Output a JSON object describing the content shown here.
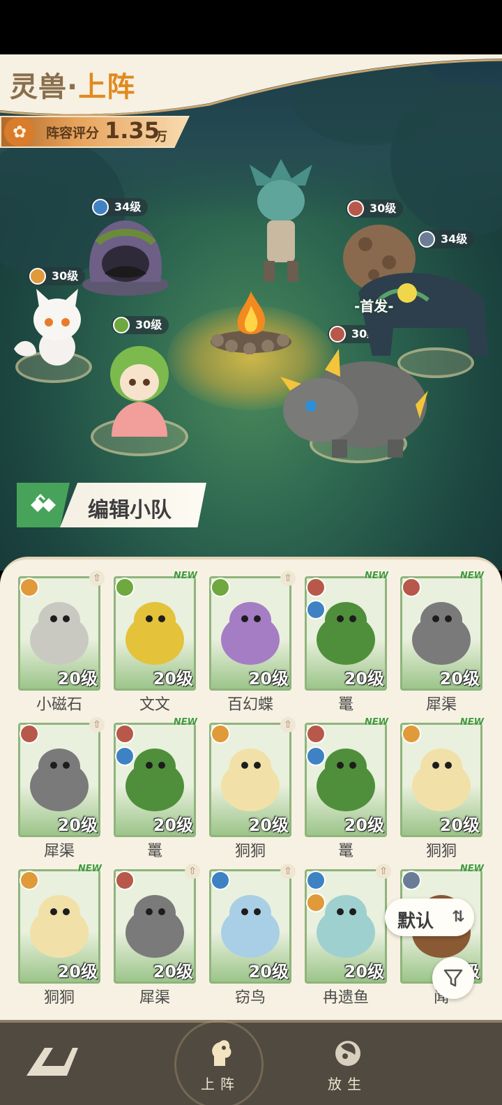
{
  "header": {
    "title_main": "灵兽·",
    "title_accent": "上阵",
    "score_label": "阵容评分",
    "score_value": "1.35",
    "score_unit": "万"
  },
  "battle": {
    "captain_label": "-首发-",
    "units": [
      {
        "id": "hooded",
        "level": "34级",
        "element": "water"
      },
      {
        "id": "masked",
        "level": "",
        "element": ""
      },
      {
        "id": "boulder",
        "level": "30级",
        "element": "fire"
      },
      {
        "id": "beast",
        "level": "34级",
        "element": "metal"
      },
      {
        "id": "fox",
        "level": "30级",
        "element": "light"
      },
      {
        "id": "sprout",
        "level": "30级",
        "element": "grass"
      },
      {
        "id": "rhino",
        "level": "30级",
        "element": "fire"
      }
    ],
    "edit_team_label": "编辑小队"
  },
  "cards": [
    {
      "name": "小磁石",
      "level": "20级",
      "element": "light",
      "new": false,
      "up": true,
      "color": "#c9c9c2"
    },
    {
      "name": "文文",
      "level": "20级",
      "element": "grass",
      "new": true,
      "up": false,
      "color": "#e4c23a"
    },
    {
      "name": "百幻蝶",
      "level": "20级",
      "element": "grass",
      "new": false,
      "up": true,
      "color": "#a57dc4"
    },
    {
      "name": "鼍",
      "level": "20级",
      "element": "fire",
      "element2": "water",
      "new": true,
      "up": false,
      "color": "#4f8f3b"
    },
    {
      "name": "犀渠",
      "level": "20级",
      "element": "fire",
      "new": true,
      "up": false,
      "color": "#7a7a7a"
    },
    {
      "name": "犀渠",
      "level": "20级",
      "element": "fire",
      "new": false,
      "up": true,
      "color": "#7a7a7a"
    },
    {
      "name": "鼍",
      "level": "20级",
      "element": "fire",
      "element2": "water",
      "new": true,
      "up": false,
      "color": "#4f8f3b"
    },
    {
      "name": "狪狪",
      "level": "20级",
      "element": "light",
      "new": false,
      "up": true,
      "color": "#f1e1a8"
    },
    {
      "name": "鼍",
      "level": "20级",
      "element": "fire",
      "element2": "water",
      "new": true,
      "up": false,
      "color": "#4f8f3b"
    },
    {
      "name": "狪狪",
      "level": "20级",
      "element": "light",
      "new": true,
      "up": false,
      "color": "#f1e1a8"
    },
    {
      "name": "狪狪",
      "level": "20级",
      "element": "light",
      "new": true,
      "up": false,
      "color": "#f1e1a8"
    },
    {
      "name": "犀渠",
      "level": "20级",
      "element": "fire",
      "new": false,
      "up": true,
      "color": "#7a7a7a"
    },
    {
      "name": "窃鸟",
      "level": "20级",
      "element": "water",
      "new": false,
      "up": true,
      "color": "#a9cfe6"
    },
    {
      "name": "冉遗鱼",
      "level": "20级",
      "element": "water",
      "element2": "light",
      "new": false,
      "up": true,
      "color": "#9fd0d0"
    },
    {
      "name": "闻",
      "level": "20级",
      "element": "metal",
      "new": true,
      "up": false,
      "color": "#8a5a34"
    }
  ],
  "sort": {
    "label": "默认",
    "icon": "swap-vertical-icon"
  },
  "filter": {
    "icon": "filter-icon"
  },
  "nav": {
    "items": [
      {
        "label": "上阵",
        "icon": "deploy-icon",
        "active": true
      },
      {
        "label": "放生",
        "icon": "release-icon",
        "active": false
      }
    ]
  },
  "colors": {
    "accent": "#e08a20",
    "panel": "#f7f1e3",
    "card_border": "#8fb47c",
    "nav_bg": "#514a40"
  }
}
